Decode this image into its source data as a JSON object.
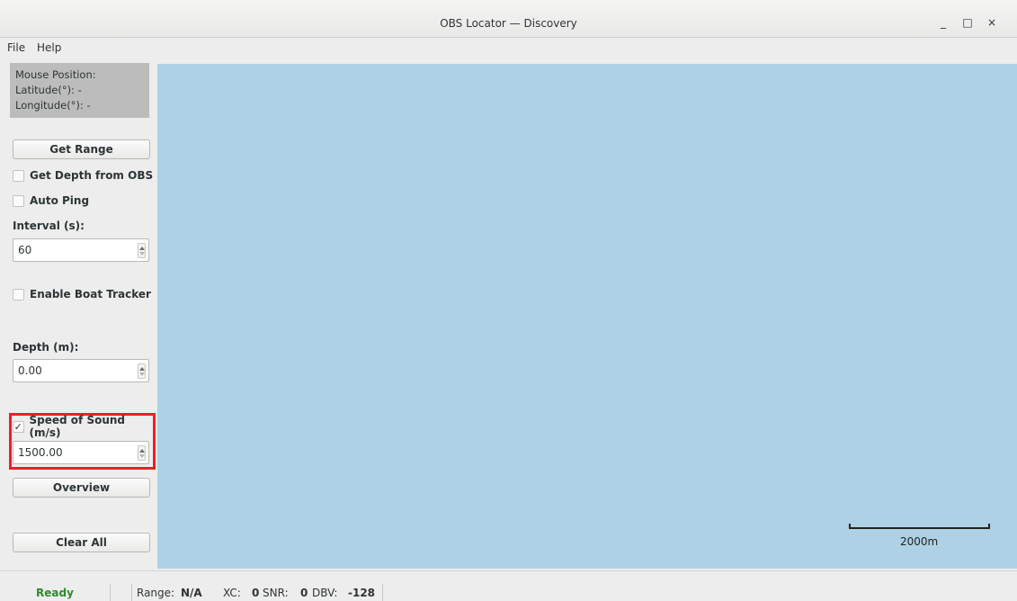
{
  "window": {
    "title": "OBS Locator — Discovery",
    "minimize": "_",
    "maximize": "□",
    "close": "×"
  },
  "menu": {
    "items": [
      "File",
      "Help"
    ]
  },
  "mouse_position": {
    "header": "Mouse Position:",
    "latitude": "Latitude(°): -",
    "longitude": "Longitude(°): -"
  },
  "controls": {
    "get_range_label": "Get Range",
    "get_depth_label": "Get Depth from OBS",
    "get_depth_checked": false,
    "auto_ping_label": "Auto Ping",
    "auto_ping_checked": false,
    "interval_label": "Interval (s):",
    "interval_value": "60",
    "boat_tracker_label": "Enable Boat Tracker",
    "boat_tracker_checked": false,
    "depth_label": "Depth (m):",
    "depth_value": "0.00",
    "sound_label": "Speed of Sound (m/s)",
    "sound_checked": true,
    "sound_check_mark": "✓",
    "sound_value": "1500.00",
    "overview_label": "Overview",
    "clear_all_label": "Clear All"
  },
  "map": {
    "water_color": "#aed1e5",
    "scale_label": "2000m"
  },
  "status": {
    "ready": "Ready",
    "range_label": "Range:",
    "range_value": "N/A",
    "xc_label": "XC:",
    "xc_value": "0",
    "snr_label": "SNR:",
    "snr_value": "0",
    "dbv_label": "DBV:",
    "dbv_value": "-128"
  },
  "colors": {
    "highlight": "#e8202a",
    "ready": "#2c8c2c"
  }
}
